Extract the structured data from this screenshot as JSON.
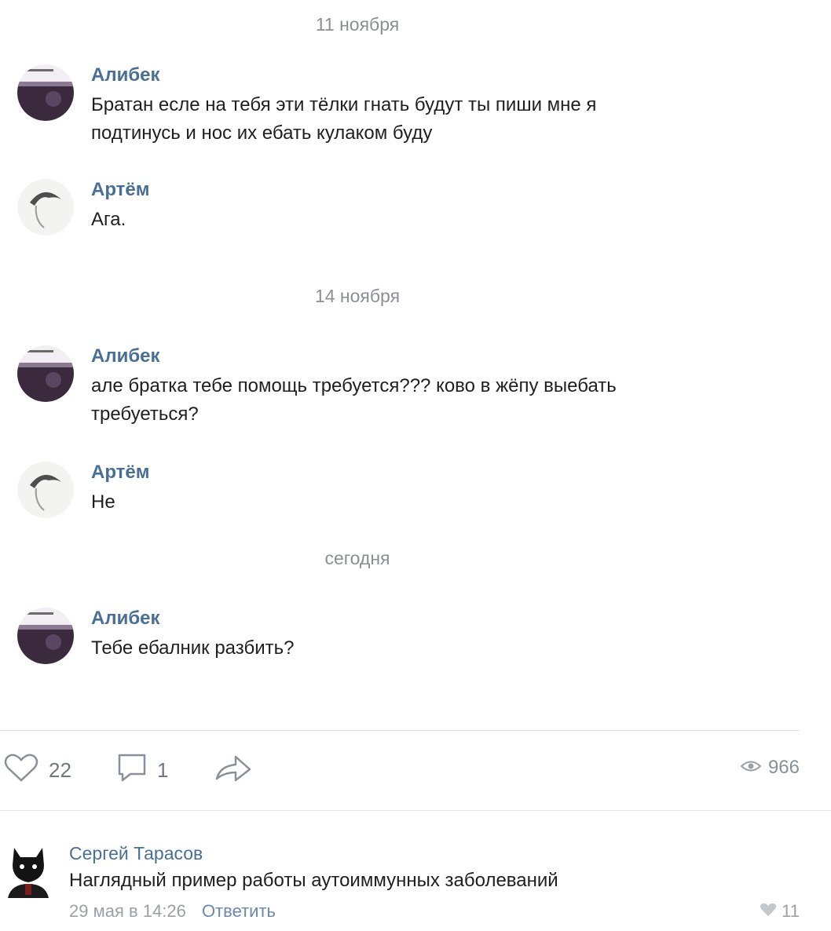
{
  "dates": [
    "11 ноября",
    "14 ноября",
    "сегодня"
  ],
  "messages": [
    {
      "author": "Алибек",
      "text": "Братан есле на тебя эти тёлки гнать будут ты пиши мне я подтинусь и нос их ебать кулаком буду"
    },
    {
      "author": "Артём",
      "text": "Ага."
    },
    {
      "author": "Алибек",
      "text": "але братка тебе помощь требуется??? ково в жёпу выебать требуеться?"
    },
    {
      "author": "Артём",
      "text": "Не"
    },
    {
      "author": "Алибек",
      "text": "Тебе ебалник разбить?"
    }
  ],
  "actions": {
    "likes": "22",
    "comments": "1",
    "views": "966"
  },
  "comment": {
    "author": "Сергей Тарасов",
    "text": "Наглядный пример работы аутоиммунных заболеваний",
    "date": "29 мая в 14:26",
    "reply_label": "Ответить",
    "likes": "11"
  },
  "icons": {
    "like": "heart-icon",
    "comment": "comment-icon",
    "share": "share-icon",
    "views": "eye-icon",
    "comment_like": "heart-icon"
  }
}
